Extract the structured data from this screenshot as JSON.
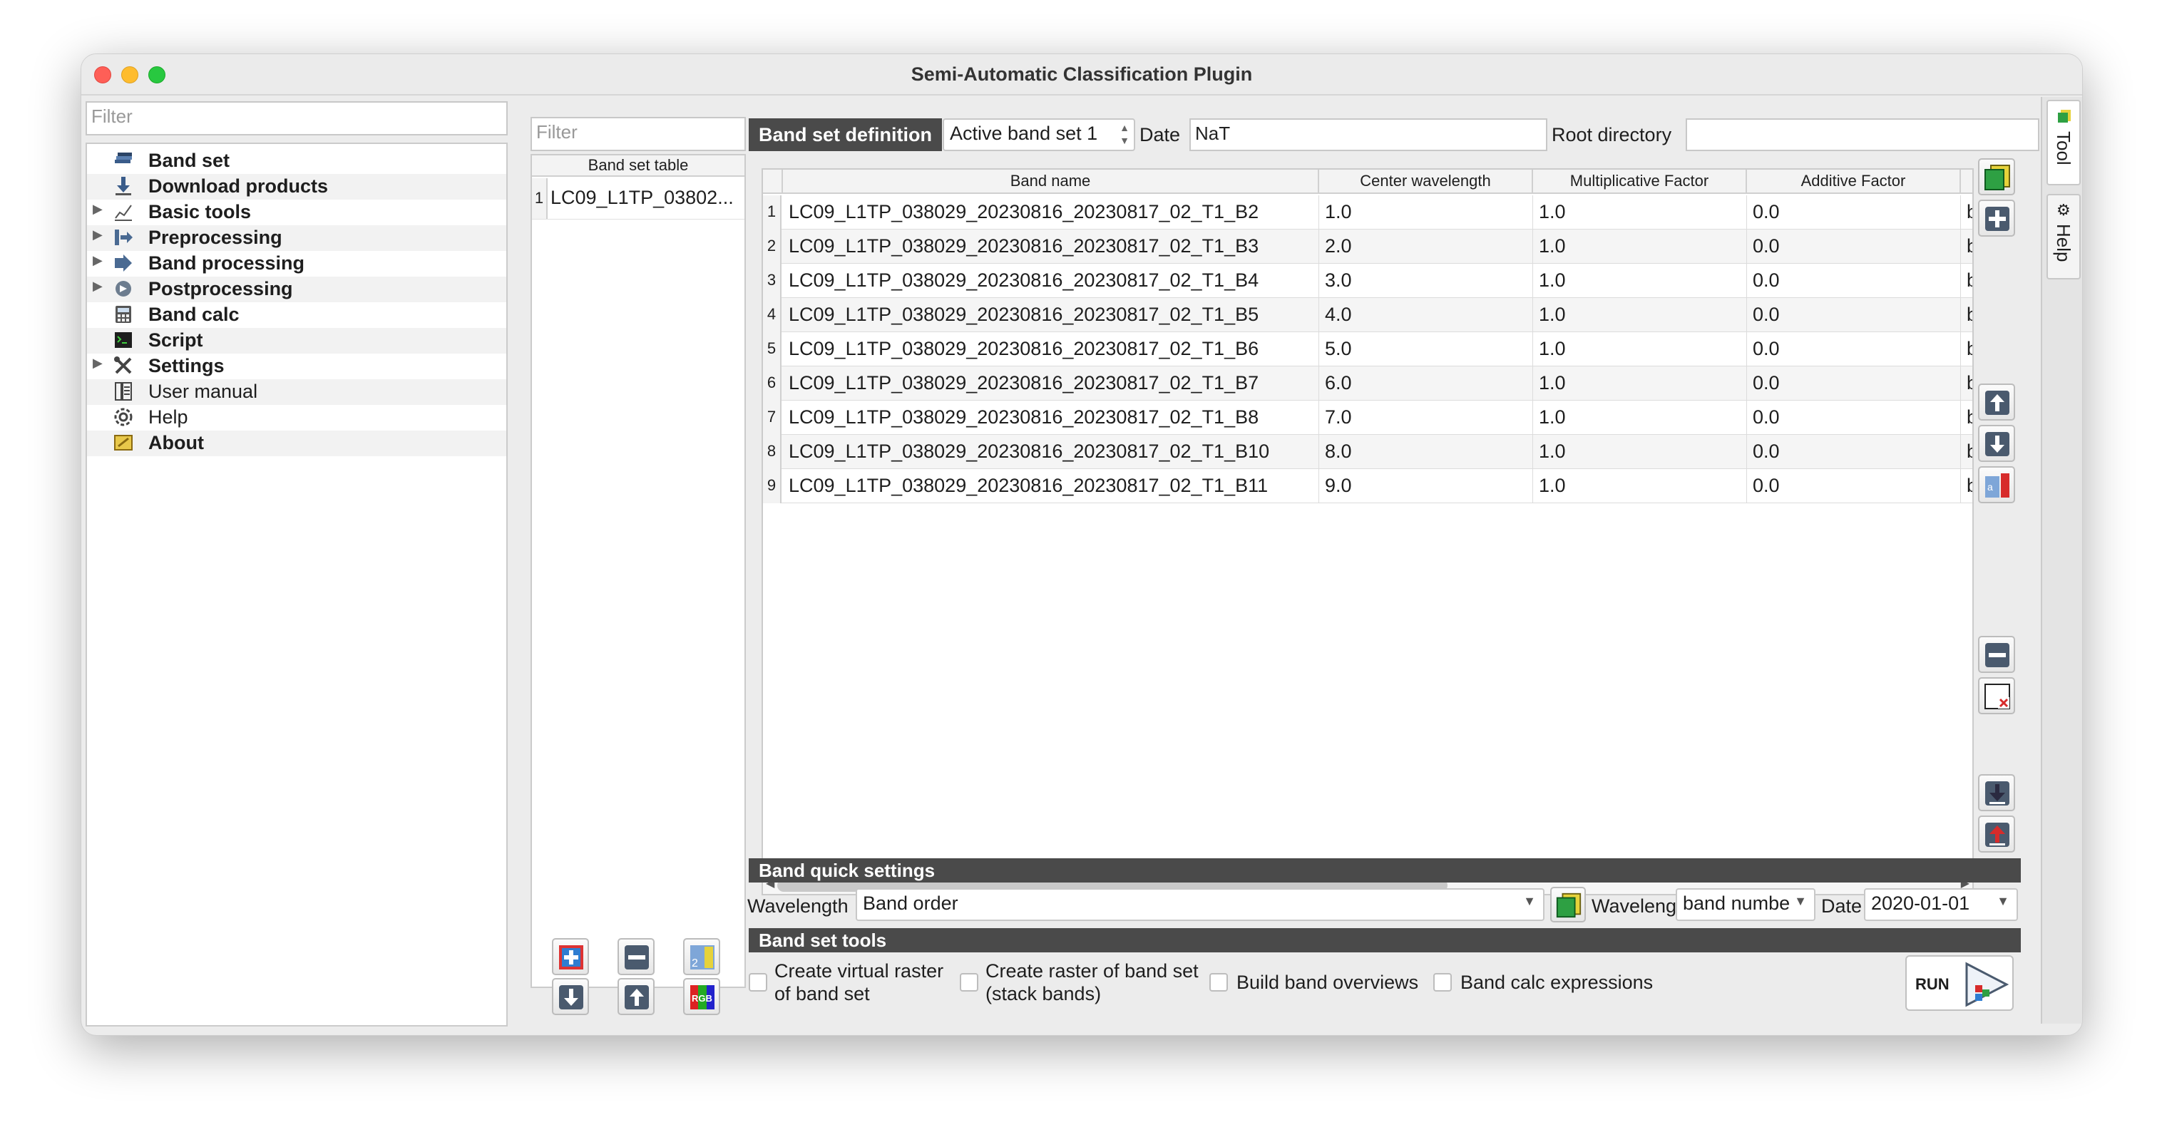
{
  "window": {
    "title": "Semi-Automatic Classification Plugin"
  },
  "nav": {
    "filter_placeholder": "Filter",
    "items": [
      {
        "label": "Band set",
        "icon": "band-set-icon",
        "bold": true
      },
      {
        "label": "Download products",
        "icon": "download-icon",
        "bold": true
      },
      {
        "label": "Basic tools",
        "icon": "basic-tools-icon",
        "bold": true
      },
      {
        "label": "Preprocessing",
        "icon": "preprocessing-icon",
        "bold": true
      },
      {
        "label": "Band processing",
        "icon": "band-processing-icon",
        "bold": true
      },
      {
        "label": "Postprocessing",
        "icon": "postprocessing-icon",
        "bold": true
      },
      {
        "label": "Band calc",
        "icon": "band-calc-icon",
        "bold": true
      },
      {
        "label": "Script",
        "icon": "script-icon",
        "bold": true
      },
      {
        "label": "Settings",
        "icon": "settings-icon",
        "bold": true
      },
      {
        "label": "User manual",
        "icon": "user-manual-icon",
        "bold": false
      },
      {
        "label": "Help",
        "icon": "help-icon",
        "bold": false
      },
      {
        "label": "About",
        "icon": "about-icon",
        "bold": true
      }
    ]
  },
  "bandset_table": {
    "filter_placeholder": "Filter",
    "header": "Band set table",
    "rows": [
      {
        "num": "1",
        "name": "LC09_L1TP_03802..."
      }
    ]
  },
  "definition": {
    "title": "Band set definition",
    "active_band_set": "Active band set 1",
    "date_label": "Date",
    "date_value": "NaT",
    "root_dir_label": "Root directory",
    "root_dir_value": ""
  },
  "table": {
    "columns": [
      "Band name",
      "Center wavelength",
      "Multiplicative Factor",
      "Additive Factor"
    ],
    "rows": [
      {
        "num": "1",
        "name": "LC09_L1TP_038029_20230816_20230817_02_T1_B2",
        "wl": "1.0",
        "mult": "1.0",
        "add": "0.0",
        "extra": "ba"
      },
      {
        "num": "2",
        "name": "LC09_L1TP_038029_20230816_20230817_02_T1_B3",
        "wl": "2.0",
        "mult": "1.0",
        "add": "0.0",
        "extra": "ba"
      },
      {
        "num": "3",
        "name": "LC09_L1TP_038029_20230816_20230817_02_T1_B4",
        "wl": "3.0",
        "mult": "1.0",
        "add": "0.0",
        "extra": "ba"
      },
      {
        "num": "4",
        "name": "LC09_L1TP_038029_20230816_20230817_02_T1_B5",
        "wl": "4.0",
        "mult": "1.0",
        "add": "0.0",
        "extra": "ba"
      },
      {
        "num": "5",
        "name": "LC09_L1TP_038029_20230816_20230817_02_T1_B6",
        "wl": "5.0",
        "mult": "1.0",
        "add": "0.0",
        "extra": "ba"
      },
      {
        "num": "6",
        "name": "LC09_L1TP_038029_20230816_20230817_02_T1_B7",
        "wl": "6.0",
        "mult": "1.0",
        "add": "0.0",
        "extra": "ba"
      },
      {
        "num": "7",
        "name": "LC09_L1TP_038029_20230816_20230817_02_T1_B8",
        "wl": "7.0",
        "mult": "1.0",
        "add": "0.0",
        "extra": "ba"
      },
      {
        "num": "8",
        "name": "LC09_L1TP_038029_20230816_20230817_02_T1_B10",
        "wl": "8.0",
        "mult": "1.0",
        "add": "0.0",
        "extra": "ba"
      },
      {
        "num": "9",
        "name": "LC09_L1TP_038029_20230816_20230817_02_T1_B11",
        "wl": "9.0",
        "mult": "1.0",
        "add": "0.0",
        "extra": "ba"
      }
    ]
  },
  "quick_settings": {
    "title": "Band quick settings",
    "wavelength_label": "Wavelength",
    "wavelength_value": "Band order",
    "wavelength_unit_label": "Wavelength unit",
    "wavelength_unit_value": "band numbe",
    "date_label": "Date",
    "date_value": "2020-01-01"
  },
  "tools": {
    "title": "Band set tools",
    "virtual_raster_line1": "Create virtual raster",
    "virtual_raster_line2": "of band set",
    "stack_line1": "Create raster of band set",
    "stack_line2": "(stack bands)",
    "overviews": "Build band overviews",
    "bandcalc": "Band calc expressions",
    "run_label": "RUN"
  },
  "dock": {
    "tab_tool": "Tool",
    "tab_help": "Help"
  },
  "colors": {
    "section_bg": "#4a4a4a",
    "accent_green": "#2ea043",
    "accent_red": "#d72b2b"
  }
}
